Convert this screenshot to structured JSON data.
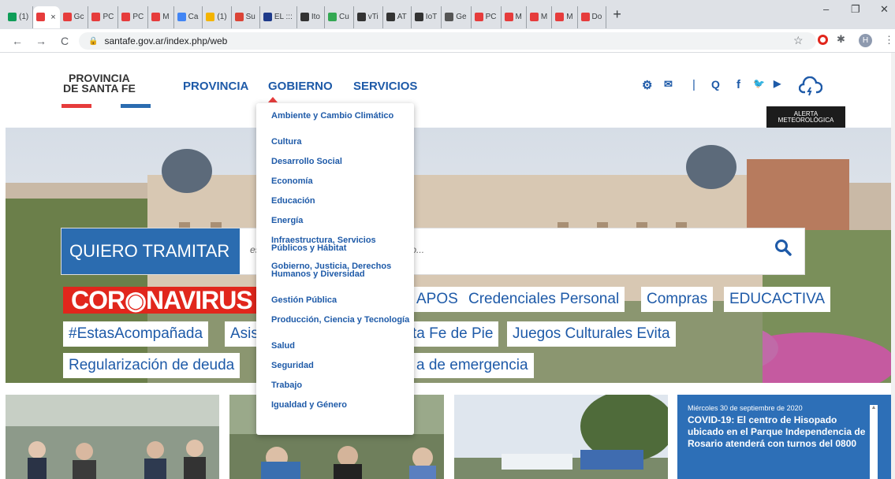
{
  "tabs": [
    {
      "label": "(1)",
      "color": "#0f9d58"
    },
    {
      "label": "",
      "color": "#e63c3c"
    },
    {
      "label": "Gc",
      "color": "#e63c3c"
    },
    {
      "label": "PC",
      "color": "#e63c3c"
    },
    {
      "label": "PC",
      "color": "#e63c3c"
    },
    {
      "label": "M",
      "color": "#e63c3c"
    },
    {
      "label": "Ca",
      "color": "#4285f4"
    },
    {
      "label": "(1)",
      "color": "#f4b400"
    },
    {
      "label": "Su",
      "color": "#db4437"
    },
    {
      "label": "EL :::",
      "color": "#1e3a8a"
    },
    {
      "label": "Ito",
      "color": "#333"
    },
    {
      "label": "Cu",
      "color": "#34a853"
    },
    {
      "label": "vTi",
      "color": "#333"
    },
    {
      "label": "AT",
      "color": "#333"
    },
    {
      "label": "IoT",
      "color": "#333"
    },
    {
      "label": "Ge",
      "color": "#555"
    },
    {
      "label": "PC",
      "color": "#e63c3c"
    },
    {
      "label": "M",
      "color": "#e63c3c"
    },
    {
      "label": "M",
      "color": "#e63c3c"
    },
    {
      "label": "M",
      "color": "#e63c3c"
    },
    {
      "label": "Do",
      "color": "#e63c3c"
    }
  ],
  "active_tab_close": "×",
  "new_tab": "+",
  "window": {
    "minimize": "–",
    "restore": "❐",
    "close": "✕"
  },
  "address": {
    "url": "santafe.gov.ar/index.php/web"
  },
  "logo": {
    "line1": "PROVINCIA",
    "line2": "DE SANTA FE",
    "red": "#e63c3c",
    "blue": "#2b6cb0"
  },
  "nav": {
    "provincia": "PROVINCIA",
    "gobierno": "GOBIERNO",
    "servicios": "SERVICIOS"
  },
  "header_icons": {
    "accessibility": "accessibility-icon",
    "mail": "mail-icon",
    "search": "search-icon",
    "facebook": "f",
    "twitter": "twitter-icon",
    "youtube": "youtube-icon",
    "alerta": "cloud-alert-icon"
  },
  "tooltip": {
    "line1": "ALERTA",
    "line2": "METEOROLÓGICA"
  },
  "search": {
    "label": "QUIERO TRAMITAR",
    "placeholder_start": "es",
    "placeholder_end": "ndo..."
  },
  "corona": "COR◉NAVIRUS",
  "pills": {
    "apos": "APOS",
    "credenciales": "Credenciales Personal",
    "compras": "Compras",
    "educactiva": "EDUCACTIVA",
    "estas": "#EstasAcompañada",
    "asis": "Asis",
    "santafe": "ta Fe de Pie",
    "juegos": "Juegos Culturales Evita",
    "regularizacion": "Regularización de deuda",
    "emergencia": "a de emergencia"
  },
  "dropdown": [
    "Ambiente y Cambio Climático",
    "Cultura",
    "Desarrollo Social",
    "Economía",
    "Educación",
    "Energía",
    "Infraestructura, Servicios Públicos y Hábitat",
    "Gobierno, Justicia, Derechos Humanos y Diversidad",
    "Gestión Pública",
    "Producción, Ciencia y Tecnología",
    "Salud",
    "Seguridad",
    "Trabajo",
    "Igualdad y Género"
  ],
  "news_card": {
    "date": "Miércoles 30 de septiembre de 2020",
    "title": "COVID-19: El centro de Hisopado ubicado en el Parque Independencia de Rosario atenderá con turnos del 0800"
  }
}
